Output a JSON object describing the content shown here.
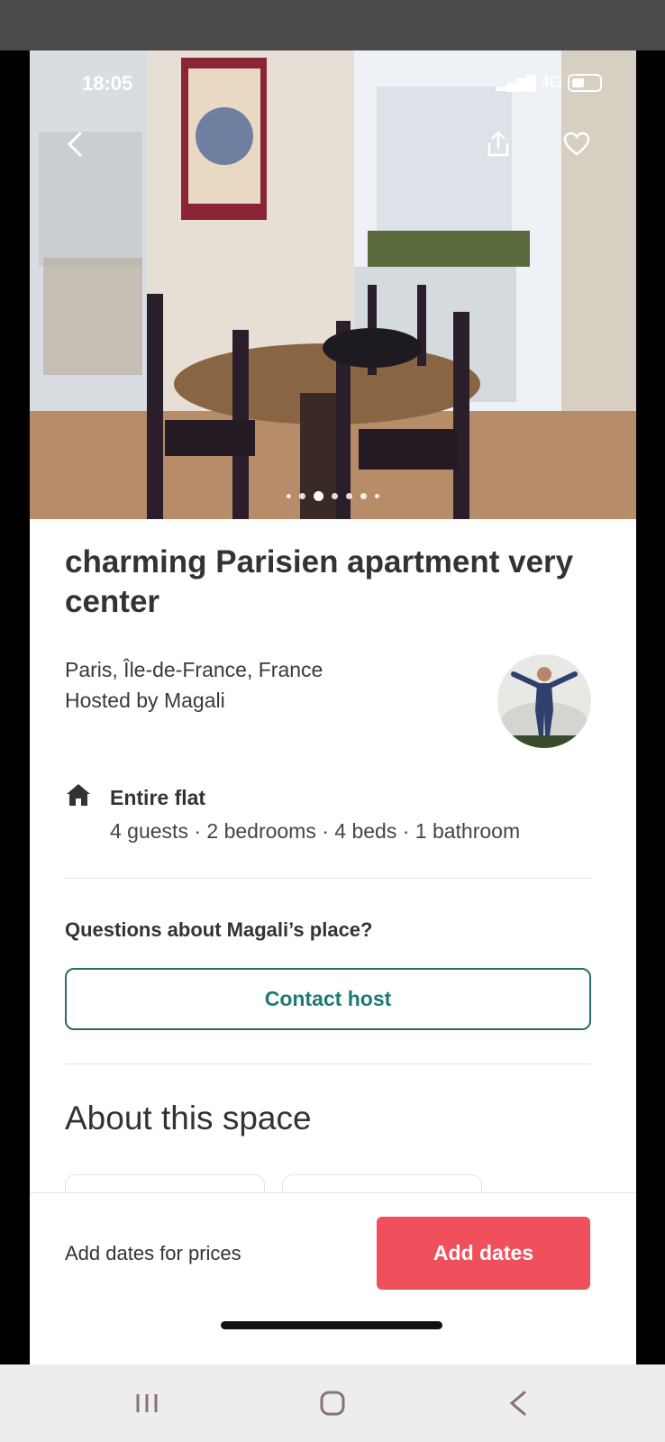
{
  "status_bar": {
    "time": "18:05",
    "network": "4G"
  },
  "listing": {
    "title": "charming Parisien apartment very center",
    "location": "Paris, Île-de-France, France",
    "hosted_by": "Hosted by Magali",
    "property_type": "Entire flat",
    "details": "4 guests · 2 bedrooms · 4 beds · 1 bathroom"
  },
  "photo_carousel": {
    "dot_count": 7,
    "active_index": 2
  },
  "contact": {
    "question": "Questions about Magali’s place?",
    "button_label": "Contact host"
  },
  "about": {
    "heading": "About this space"
  },
  "booking_bar": {
    "prices_text": "Add dates for prices",
    "button_label": "Add dates"
  },
  "colors": {
    "accent": "#f0505b",
    "contact_teal": "#1d7a70",
    "status_bar_bg": "#4a4a4a"
  },
  "icons": [
    "back-arrow-icon",
    "share-icon",
    "heart-icon",
    "house-icon",
    "recent-apps-icon",
    "home-icon",
    "back-icon"
  ]
}
